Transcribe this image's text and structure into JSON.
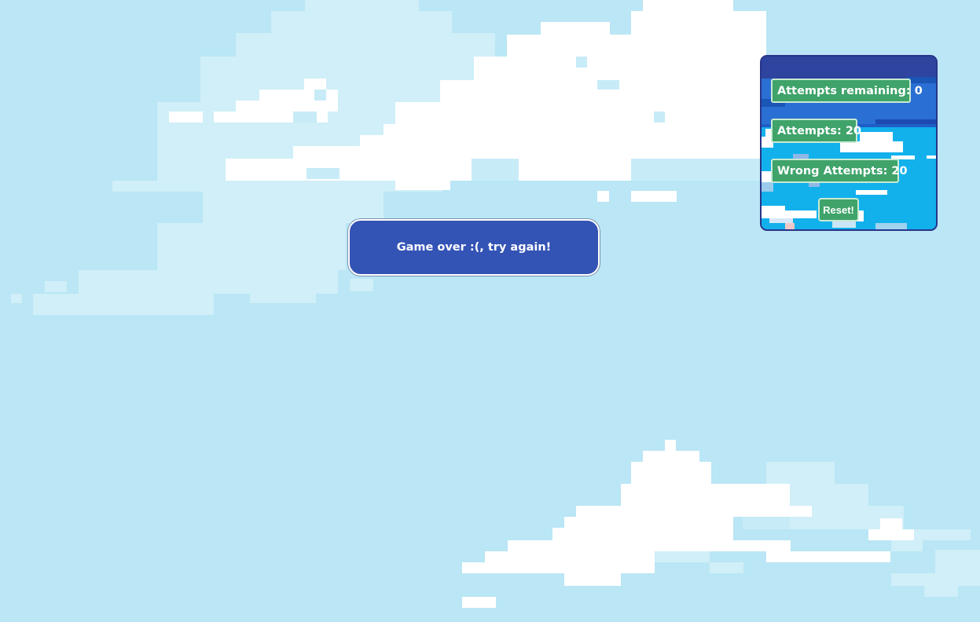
{
  "banner": {
    "message": "Game over :(, try again!"
  },
  "stats": {
    "attempts_remaining": "Attempts remaining: 0",
    "attempts": "Attempts: 20",
    "wrong_attempts": "Wrong Attempts: 20"
  },
  "controls": {
    "reset_label": "Reset!"
  },
  "colors": {
    "sky": "#bae6f5",
    "cloud": "#ffffff",
    "cloud_pale": "#d0eff8",
    "banner_bg": "#3353b5",
    "panel_border": "#27348a",
    "stat_green": "#3fa36a"
  }
}
